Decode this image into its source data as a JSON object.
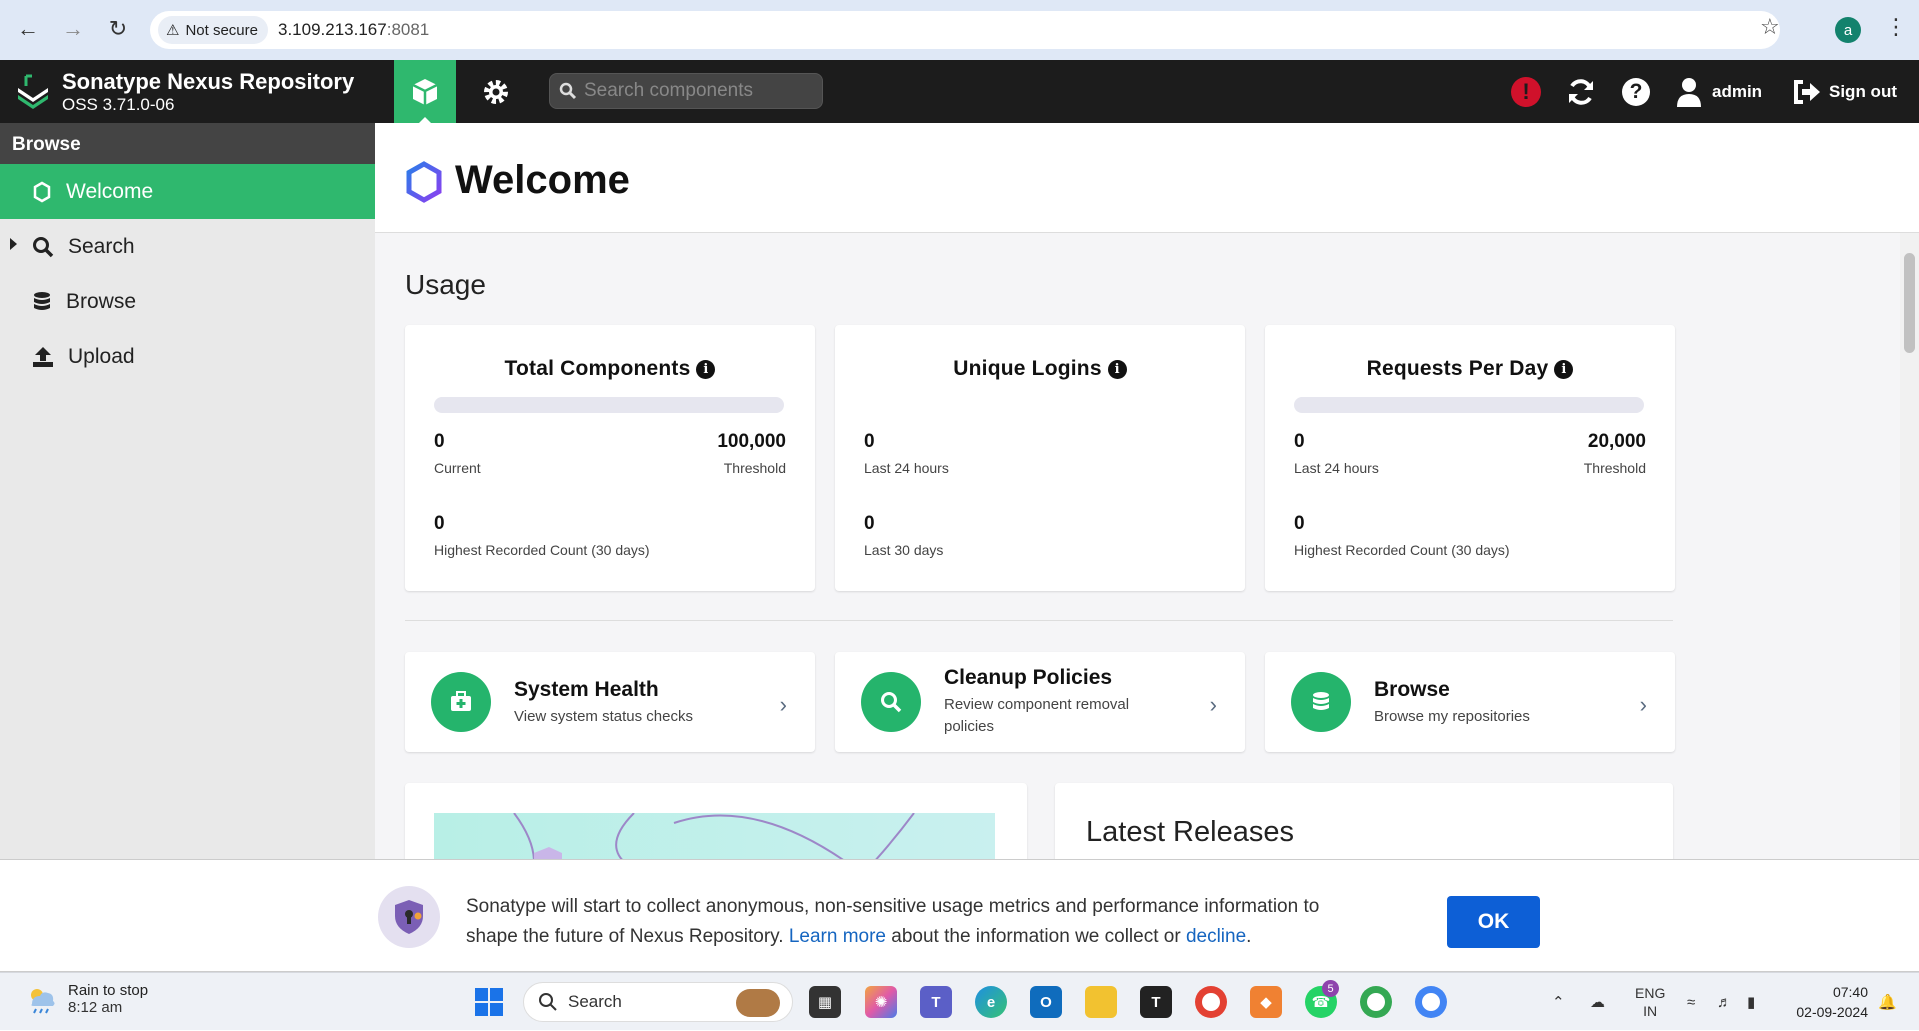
{
  "browser": {
    "security_label": "Not secure",
    "url_host": "3.109.213.167",
    "url_port": ":8081",
    "profile_initial": "a"
  },
  "header": {
    "brand_title": "Sonatype Nexus Repository",
    "brand_version": "OSS 3.71.0-06",
    "search_placeholder": "Search components",
    "user_label": "admin",
    "signout_label": "Sign out"
  },
  "sidebar": {
    "heading": "Browse",
    "items": [
      {
        "label": "Welcome",
        "icon": "hexagon-icon"
      },
      {
        "label": "Search",
        "icon": "search-icon"
      },
      {
        "label": "Browse",
        "icon": "database-icon"
      },
      {
        "label": "Upload",
        "icon": "upload-icon"
      }
    ]
  },
  "main": {
    "title": "Welcome",
    "usage_heading": "Usage",
    "usage_cards": [
      {
        "title": "Total Components",
        "current": "0",
        "current_label": "Current",
        "threshold": "100,000",
        "threshold_label": "Threshold",
        "highest": "0",
        "highest_label": "Highest Recorded Count (30 days)"
      },
      {
        "title": "Unique Logins",
        "current": "0",
        "current_label": "Last 24 hours",
        "highest": "0",
        "highest_label": "Last 30 days"
      },
      {
        "title": "Requests Per Day",
        "current": "0",
        "current_label": "Last 24 hours",
        "threshold": "20,000",
        "threshold_label": "Threshold",
        "highest": "0",
        "highest_label": "Highest Recorded Count (30 days)"
      }
    ],
    "link_cards": [
      {
        "title": "System Health",
        "desc": "View system status checks"
      },
      {
        "title": "Cleanup Policies",
        "desc": "Review component removal policies"
      },
      {
        "title": "Browse",
        "desc": "Browse my repositories"
      }
    ],
    "latest_releases": "Latest Releases"
  },
  "banner": {
    "text_before": "Sonatype will start to collect anonymous, non-sensitive usage metrics and performance information to shape the future of Nexus Repository.",
    "learn_more": "Learn more",
    "text_middle": "about the information we collect or",
    "decline": "decline",
    "text_end": ".",
    "ok_label": "OK"
  },
  "taskbar": {
    "weather_title": "Rain to stop",
    "weather_time": "8:12 am",
    "search_label": "Search",
    "lang_top": "ENG",
    "lang_bottom": "IN",
    "time": "07:40",
    "date": "02-09-2024",
    "badge_whatsapp": "5"
  },
  "colors": {
    "accent_green": "#2fb86e",
    "header_bg": "#1c1c1c",
    "ok_blue": "#0d5fd6",
    "alert_red": "#d0112b"
  }
}
